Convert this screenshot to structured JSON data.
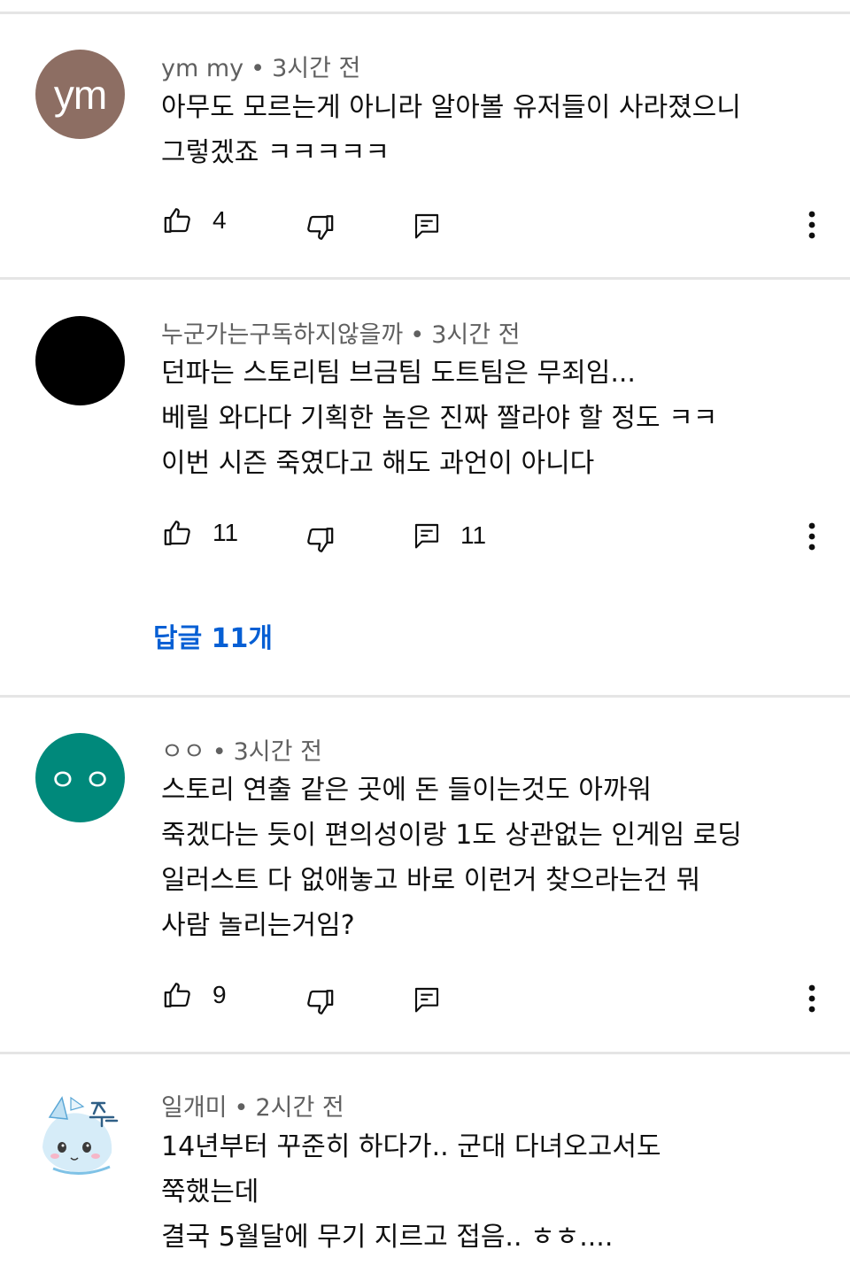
{
  "comments": [
    {
      "avatar_text": "ym",
      "author": "ym my",
      "time": "3시간 전",
      "text": "아무도 모르는게 아니라 알아볼 유저들이 사라졌으니\n그렇겠죠 ㅋㅋㅋㅋㅋ",
      "likes": "4",
      "reply_count": ""
    },
    {
      "avatar_text": "",
      "author": "누군가는구독하지않을까",
      "time": "3시간 전",
      "text": "던파는 스토리팀 브금팀 도트팀은 무죄임...\n베릴 와다다 기획한 놈은 진짜 짤라야 할 정도 ㅋㅋ\n이번 시즌 죽였다고 해도 과언이 아니다",
      "likes": "11",
      "reply_count": "11",
      "replies_link": "답글 11개"
    },
    {
      "avatar_text": "ㅇㅇ",
      "author": "ㅇㅇ",
      "time": "3시간 전",
      "text": "스토리 연출 같은 곳에 돈 들이는것도 아까워\n죽겠다는 듯이 편의성이랑 1도 상관없는 인게임 로딩\n일러스트 다 없애놓고 바로 이런거 찾으라는건 뭐\n사람 놀리는거임?",
      "likes": "9",
      "reply_count": ""
    },
    {
      "avatar_text": "",
      "author": "일개미",
      "time": "2시간 전",
      "text": "14년부터 꾸준히 하다가.. 군대 다녀오고서도\n쭉했는데\n결국 5월달에 무기 지르고 접음.. ㅎㅎ....",
      "likes": "",
      "reply_count": ""
    }
  ],
  "meta_separator": "•",
  "colors": {
    "avatar_ym": "#8d6e63",
    "avatar_oo": "#00897b",
    "link": "#065fd4",
    "secondary_text": "#606060",
    "divider": "#e5e5e5"
  },
  "icons": [
    "thumbs-up-icon",
    "thumbs-down-icon",
    "reply-icon",
    "more-vert-icon"
  ]
}
